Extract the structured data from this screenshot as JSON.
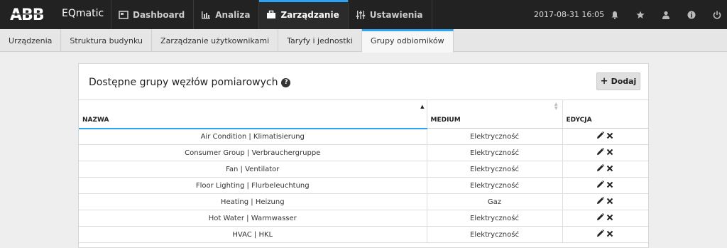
{
  "brand": {
    "logo": "ABB",
    "app_name": "EQmatic"
  },
  "nav": [
    {
      "label": "Dashboard",
      "icon": "dashboard-icon"
    },
    {
      "label": "Analiza",
      "icon": "bar-chart-icon"
    },
    {
      "label": "Zarządzanie",
      "icon": "briefcase-icon",
      "active": true
    },
    {
      "label": "Ustawienia",
      "icon": "sliders-icon"
    }
  ],
  "header": {
    "datetime": "2017-08-31 16:05",
    "icons": [
      "bell-icon",
      "star-icon",
      "user-icon",
      "info-icon",
      "power-icon"
    ]
  },
  "subtabs": [
    {
      "label": "Urządzenia"
    },
    {
      "label": "Struktura budynku"
    },
    {
      "label": "Zarządzanie użytkownikami"
    },
    {
      "label": "Taryfy i jednostki"
    },
    {
      "label": "Grupy odbiorników",
      "active": true
    }
  ],
  "panel": {
    "title": "Dostępne grupy węzłów pomiarowych",
    "help": "?",
    "add_label": "Dodaj"
  },
  "table": {
    "columns": [
      "NAZWA",
      "MEDIUM",
      "EDYCJA"
    ],
    "rows": [
      {
        "name": "Air Condition | Klimatisierung",
        "medium": "Elektryczność"
      },
      {
        "name": "Consumer Group | Verbrauchergruppe",
        "medium": "Elektryczność"
      },
      {
        "name": "Fan | Ventilator",
        "medium": "Elektryczność"
      },
      {
        "name": "Floor Lighting | Flurbeleuchtung",
        "medium": "Elektryczność"
      },
      {
        "name": "Heating | Heizung",
        "medium": "Gaz"
      },
      {
        "name": "Hot Water | Warmwasser",
        "medium": "Elektryczność"
      },
      {
        "name": "HVAC | HKL",
        "medium": "Elektryczność"
      }
    ]
  },
  "colors": {
    "accent": "#2ea3f2",
    "topbar": "#222222"
  }
}
